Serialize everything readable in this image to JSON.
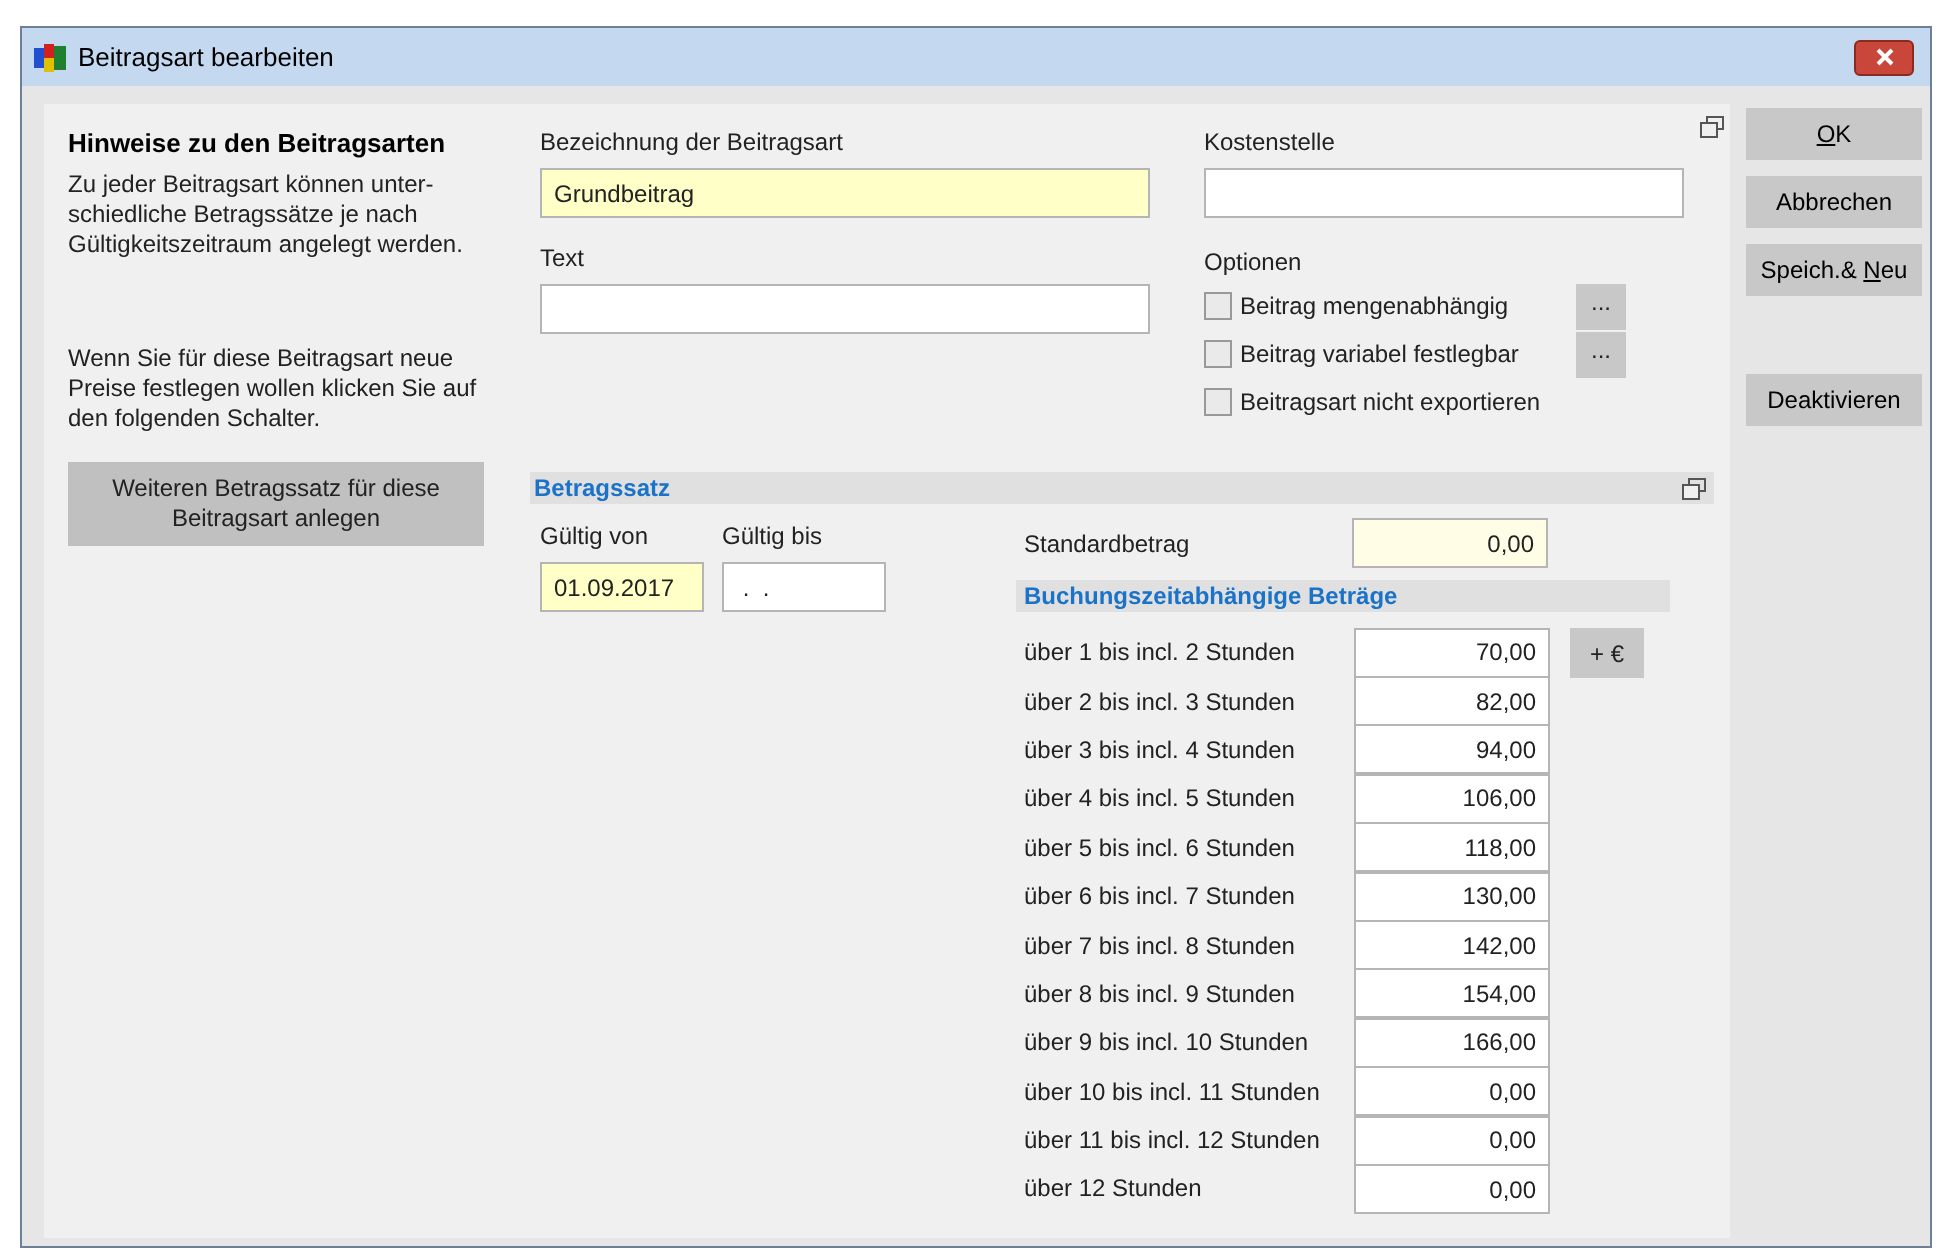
{
  "window": {
    "title": "Beitragsart bearbeiten"
  },
  "hints": {
    "title": "Hinweise zu den Beitragsarten",
    "text": "Zu jeder Beitragsart können unter-schiedliche Betragssätze je nach Gültigkeitszeitraum angelegt werden.",
    "text2": "Wenn Sie für diese Beitragsart neue Preise festlegen wollen klicken Sie auf den folgenden Schalter.",
    "button": "Weiteren Betragssatz für diese Beitragsart anlegen"
  },
  "fields": {
    "bezeichnung": {
      "label": "Bezeichnung der Beitragsart",
      "value": "Grundbeitrag"
    },
    "text": {
      "label": "Text"
    },
    "kostenstelle": {
      "label": "Kostenstelle"
    }
  },
  "options": {
    "label": "Optionen",
    "items": [
      {
        "label": "Beitrag mengenabhängig",
        "checked": false,
        "button": "..."
      },
      {
        "label": "Beitrag variabel festlegbar",
        "checked": false,
        "button": "..."
      },
      {
        "label": "Beitragsart nicht exportieren",
        "checked": false
      }
    ]
  },
  "betragssatz": {
    "title": "Betragssatz",
    "von": {
      "label": "Gültig von",
      "value": "01.09.2017"
    },
    "bis": {
      "label": "Gültig bis",
      "value": " .  ."
    },
    "standard": {
      "label": "Standardbetrag",
      "value": "0,00"
    },
    "sub_title": "Buchungszeitabhängige Beträge",
    "add_button": "+ €",
    "rows": [
      {
        "label": "über 1 bis incl. 2 Stunden",
        "value": "70,00"
      },
      {
        "label": "über 2 bis incl. 3 Stunden",
        "value": "82,00"
      },
      {
        "label": "über 3 bis incl. 4 Stunden",
        "value": "94,00"
      },
      {
        "label": "über 4 bis incl. 5 Stunden",
        "value": "106,00"
      },
      {
        "label": "über 5 bis incl. 6 Stunden",
        "value": "118,00"
      },
      {
        "label": "über 6 bis incl. 7 Stunden",
        "value": "130,00"
      },
      {
        "label": "über 7 bis incl. 8 Stunden",
        "value": "142,00"
      },
      {
        "label": "über 8 bis incl. 9 Stunden",
        "value": "154,00"
      },
      {
        "label": "über 9 bis incl. 10 Stunden",
        "value": "166,00"
      },
      {
        "label": "über 10 bis incl. 11 Stunden",
        "value": "0,00"
      },
      {
        "label": "über 11 bis incl. 12 Stunden",
        "value": "0,00"
      },
      {
        "label": "über 12 Stunden",
        "value": "0,00"
      }
    ]
  },
  "buttons": [
    {
      "key": "O",
      "after": "K"
    },
    {
      "before": "Abbrechen"
    },
    {
      "before": "Speich.& ",
      "key": "N",
      "after": "eu"
    },
    {
      "before": "Deaktivieren",
      "kind": "spaced"
    }
  ]
}
